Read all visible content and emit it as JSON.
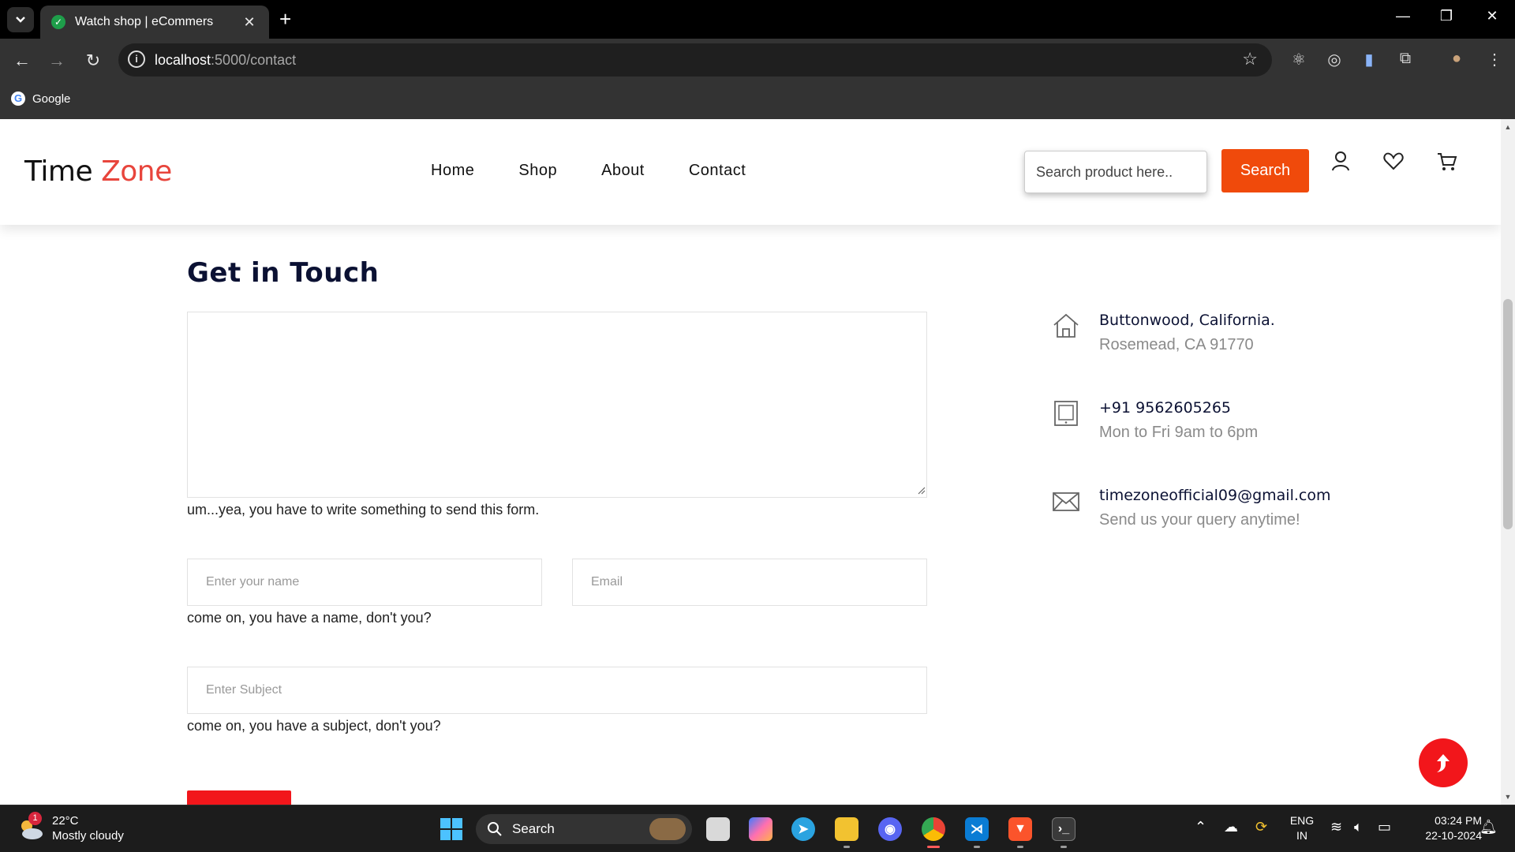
{
  "browser": {
    "tab_title": "Watch shop | eCommers",
    "url_host": "localhost",
    "url_path": ":5000/contact",
    "bookmark_label": "Google"
  },
  "site": {
    "logo_main": "Time",
    "logo_accent": "Zone",
    "nav": [
      "Home",
      "Shop",
      "About",
      "Contact"
    ],
    "search_placeholder": "Search product here..",
    "search_button": "Search"
  },
  "contact": {
    "title": "Get in Touch",
    "message_hint": "um...yea, you have to write something to send this form.",
    "name_placeholder": "Enter your name",
    "email_placeholder": "Email",
    "name_hint": "come on, you have a name, don't you?",
    "subject_placeholder": "Enter Subject",
    "subject_hint": "come on, you have a subject, don't you?"
  },
  "info": [
    {
      "icon": "home-icon",
      "title": "Buttonwood, California.",
      "sub": "Rosemead, CA 91770"
    },
    {
      "icon": "tablet-icon",
      "title": "+91 9562605265",
      "sub": "Mon to Fri 9am to 6pm"
    },
    {
      "icon": "mail-icon",
      "title": "timezoneofficial09@gmail.com",
      "sub": "Send us your query anytime!"
    }
  ],
  "taskbar": {
    "weather_badge": "1",
    "temp": "22°C",
    "condition": "Mostly cloudy",
    "search_label": "Search",
    "lang": "ENG",
    "region": "IN",
    "time": "03:24 PM",
    "date": "22-10-2024"
  },
  "colors": {
    "accent": "#e8453c",
    "search_button": "#f04a0b",
    "submit": "#f2161b",
    "heading": "#0b1133"
  }
}
